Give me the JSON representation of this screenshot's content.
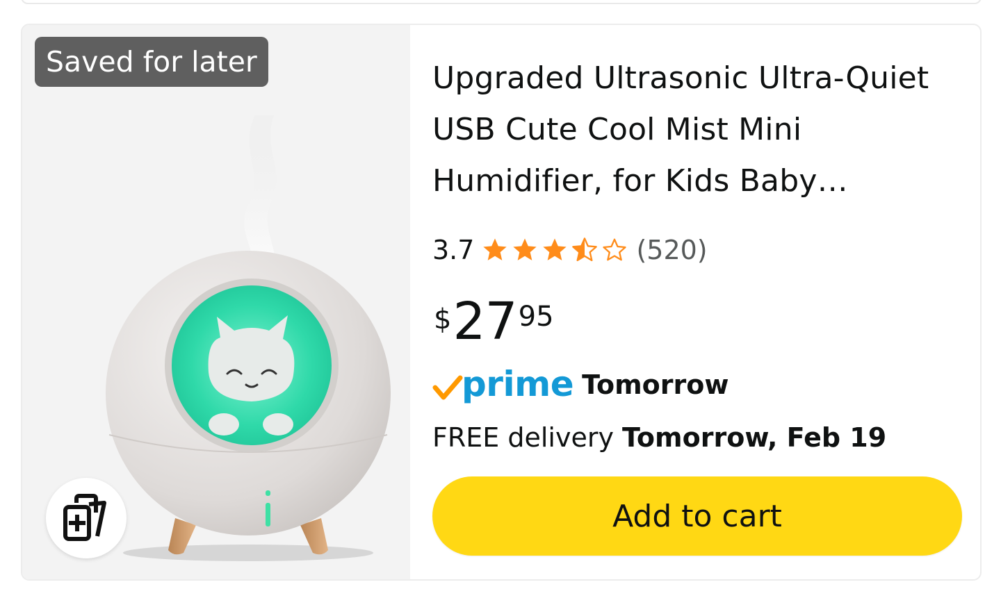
{
  "item": {
    "badge": "Saved for later",
    "title": "Upgraded Ultrasonic Ultra-Quiet USB Cute Cool Mist Mini Humidifier, for Kids Baby…",
    "rating": "3.7",
    "rating_value": 3.7,
    "rating_max": 5,
    "review_count": "(520)",
    "price": {
      "symbol": "$",
      "whole": "27",
      "fraction": "95"
    },
    "prime": {
      "logo_text": "prime",
      "delivery_speed": "Tomorrow"
    },
    "delivery": {
      "prefix": "FREE delivery ",
      "date": "Tomorrow, Feb 19"
    },
    "add_to_cart_label": "Add to cart"
  },
  "colors": {
    "star": "#ff8c1a",
    "prime_blue": "#1399d6",
    "prime_check": "#ff9900",
    "cart_button": "#ffd814",
    "badge_bg": "#5f5f5f"
  },
  "icons": {
    "compare": "compare-cards-icon",
    "prime_check": "checkmark-icon",
    "star": "star-icon"
  }
}
